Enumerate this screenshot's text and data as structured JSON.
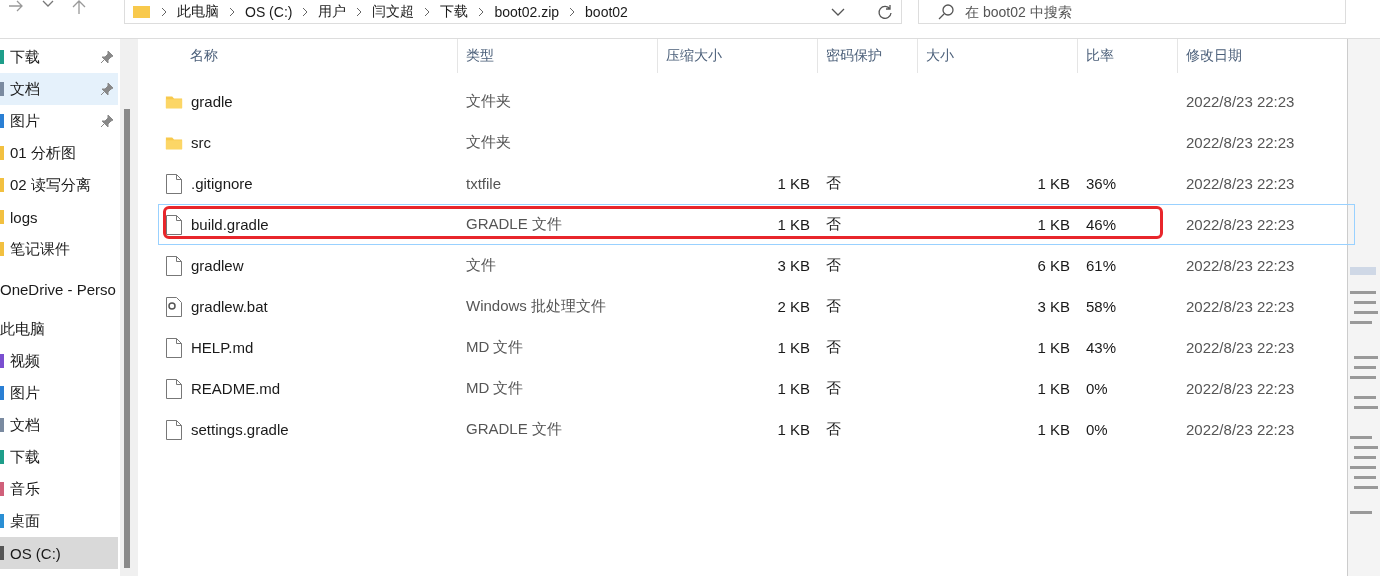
{
  "address_bar": {
    "crumbs": [
      "此电脑",
      "OS (C:)",
      "用户",
      "闫文超",
      "下载",
      "boot02.zip",
      "boot02"
    ]
  },
  "search": {
    "placeholder": "在 boot02 中搜索"
  },
  "sidebar": {
    "items": [
      {
        "label": "下载",
        "kind": "item",
        "color": "#1e9e8a",
        "pinned": true,
        "selected": false,
        "hovered": false
      },
      {
        "label": "文档",
        "kind": "item",
        "color": "#7a8aa0",
        "pinned": true,
        "selected": true,
        "hovered": false
      },
      {
        "label": "图片",
        "kind": "item",
        "color": "#2a7fd4",
        "pinned": true,
        "selected": false,
        "hovered": false
      },
      {
        "label": "01 分析图",
        "kind": "item",
        "color": "#f2c040",
        "pinned": false,
        "selected": false,
        "hovered": false
      },
      {
        "label": "02 读写分离",
        "kind": "item",
        "color": "#f2c040",
        "pinned": false,
        "selected": false,
        "hovered": false
      },
      {
        "label": "logs",
        "kind": "item",
        "color": "#f2c040",
        "pinned": false,
        "selected": false,
        "hovered": false
      },
      {
        "label": "笔记课件",
        "kind": "item",
        "color": "#f2c040",
        "pinned": false,
        "selected": false,
        "hovered": false
      },
      {
        "label": "OneDrive - Perso",
        "kind": "header",
        "pinned": false,
        "selected": false,
        "hovered": false
      },
      {
        "label": "此电脑",
        "kind": "header",
        "pinned": false,
        "selected": false,
        "hovered": false
      },
      {
        "label": "视频",
        "kind": "item",
        "color": "#7a4fd0",
        "pinned": false,
        "selected": false,
        "hovered": false
      },
      {
        "label": "图片",
        "kind": "item",
        "color": "#2a7fd4",
        "pinned": false,
        "selected": false,
        "hovered": false
      },
      {
        "label": "文档",
        "kind": "item",
        "color": "#7a8aa0",
        "pinned": false,
        "selected": false,
        "hovered": false
      },
      {
        "label": "下载",
        "kind": "item",
        "color": "#1e9e8a",
        "pinned": false,
        "selected": false,
        "hovered": false
      },
      {
        "label": "音乐",
        "kind": "item",
        "color": "#d0607a",
        "pinned": false,
        "selected": false,
        "hovered": false
      },
      {
        "label": "桌面",
        "kind": "item",
        "color": "#2a8fd4",
        "pinned": false,
        "selected": false,
        "hovered": false
      },
      {
        "label": "OS (C:)",
        "kind": "item",
        "color": "#555555",
        "pinned": false,
        "selected": false,
        "hovered": true
      }
    ]
  },
  "table": {
    "columns": [
      "名称",
      "类型",
      "压缩大小",
      "密码保护",
      "大小",
      "比率",
      "修改日期"
    ],
    "rows": [
      {
        "kind": "folder",
        "name": "gradle",
        "type": "文件夹",
        "date": "2022/8/23 22:23",
        "focused": false
      },
      {
        "kind": "folder",
        "name": "src",
        "type": "文件夹",
        "date": "2022/8/23 22:23",
        "focused": false
      },
      {
        "kind": "file",
        "name": ".gitignore",
        "type": "txtfile",
        "packed": "1 KB",
        "password": "否",
        "size": "1 KB",
        "ratio": "36%",
        "date": "2022/8/23 22:23",
        "focused": false
      },
      {
        "kind": "file",
        "name": "build.gradle",
        "type": "GRADLE 文件",
        "packed": "1 KB",
        "password": "否",
        "size": "1 KB",
        "ratio": "46%",
        "date": "2022/8/23 22:23",
        "focused": true,
        "annotated": true
      },
      {
        "kind": "file",
        "name": "gradlew",
        "type": "文件",
        "packed": "3 KB",
        "password": "否",
        "size": "6 KB",
        "ratio": "61%",
        "date": "2022/8/23 22:23",
        "focused": false
      },
      {
        "kind": "script",
        "name": "gradlew.bat",
        "type": "Windows 批处理文件",
        "packed": "2 KB",
        "password": "否",
        "size": "3 KB",
        "ratio": "58%",
        "date": "2022/8/23 22:23",
        "focused": false
      },
      {
        "kind": "file",
        "name": "HELP.md",
        "type": "MD 文件",
        "packed": "1 KB",
        "password": "否",
        "size": "1 KB",
        "ratio": "43%",
        "date": "2022/8/23 22:23",
        "focused": false
      },
      {
        "kind": "file",
        "name": "README.md",
        "type": "MD 文件",
        "packed": "1 KB",
        "password": "否",
        "size": "1 KB",
        "ratio": "0%",
        "date": "2022/8/23 22:23",
        "focused": false
      },
      {
        "kind": "file",
        "name": "settings.gradle",
        "type": "GRADLE 文件",
        "packed": "1 KB",
        "password": "否",
        "size": "1 KB",
        "ratio": "0%",
        "date": "2022/8/23 22:23",
        "focused": false
      }
    ]
  }
}
